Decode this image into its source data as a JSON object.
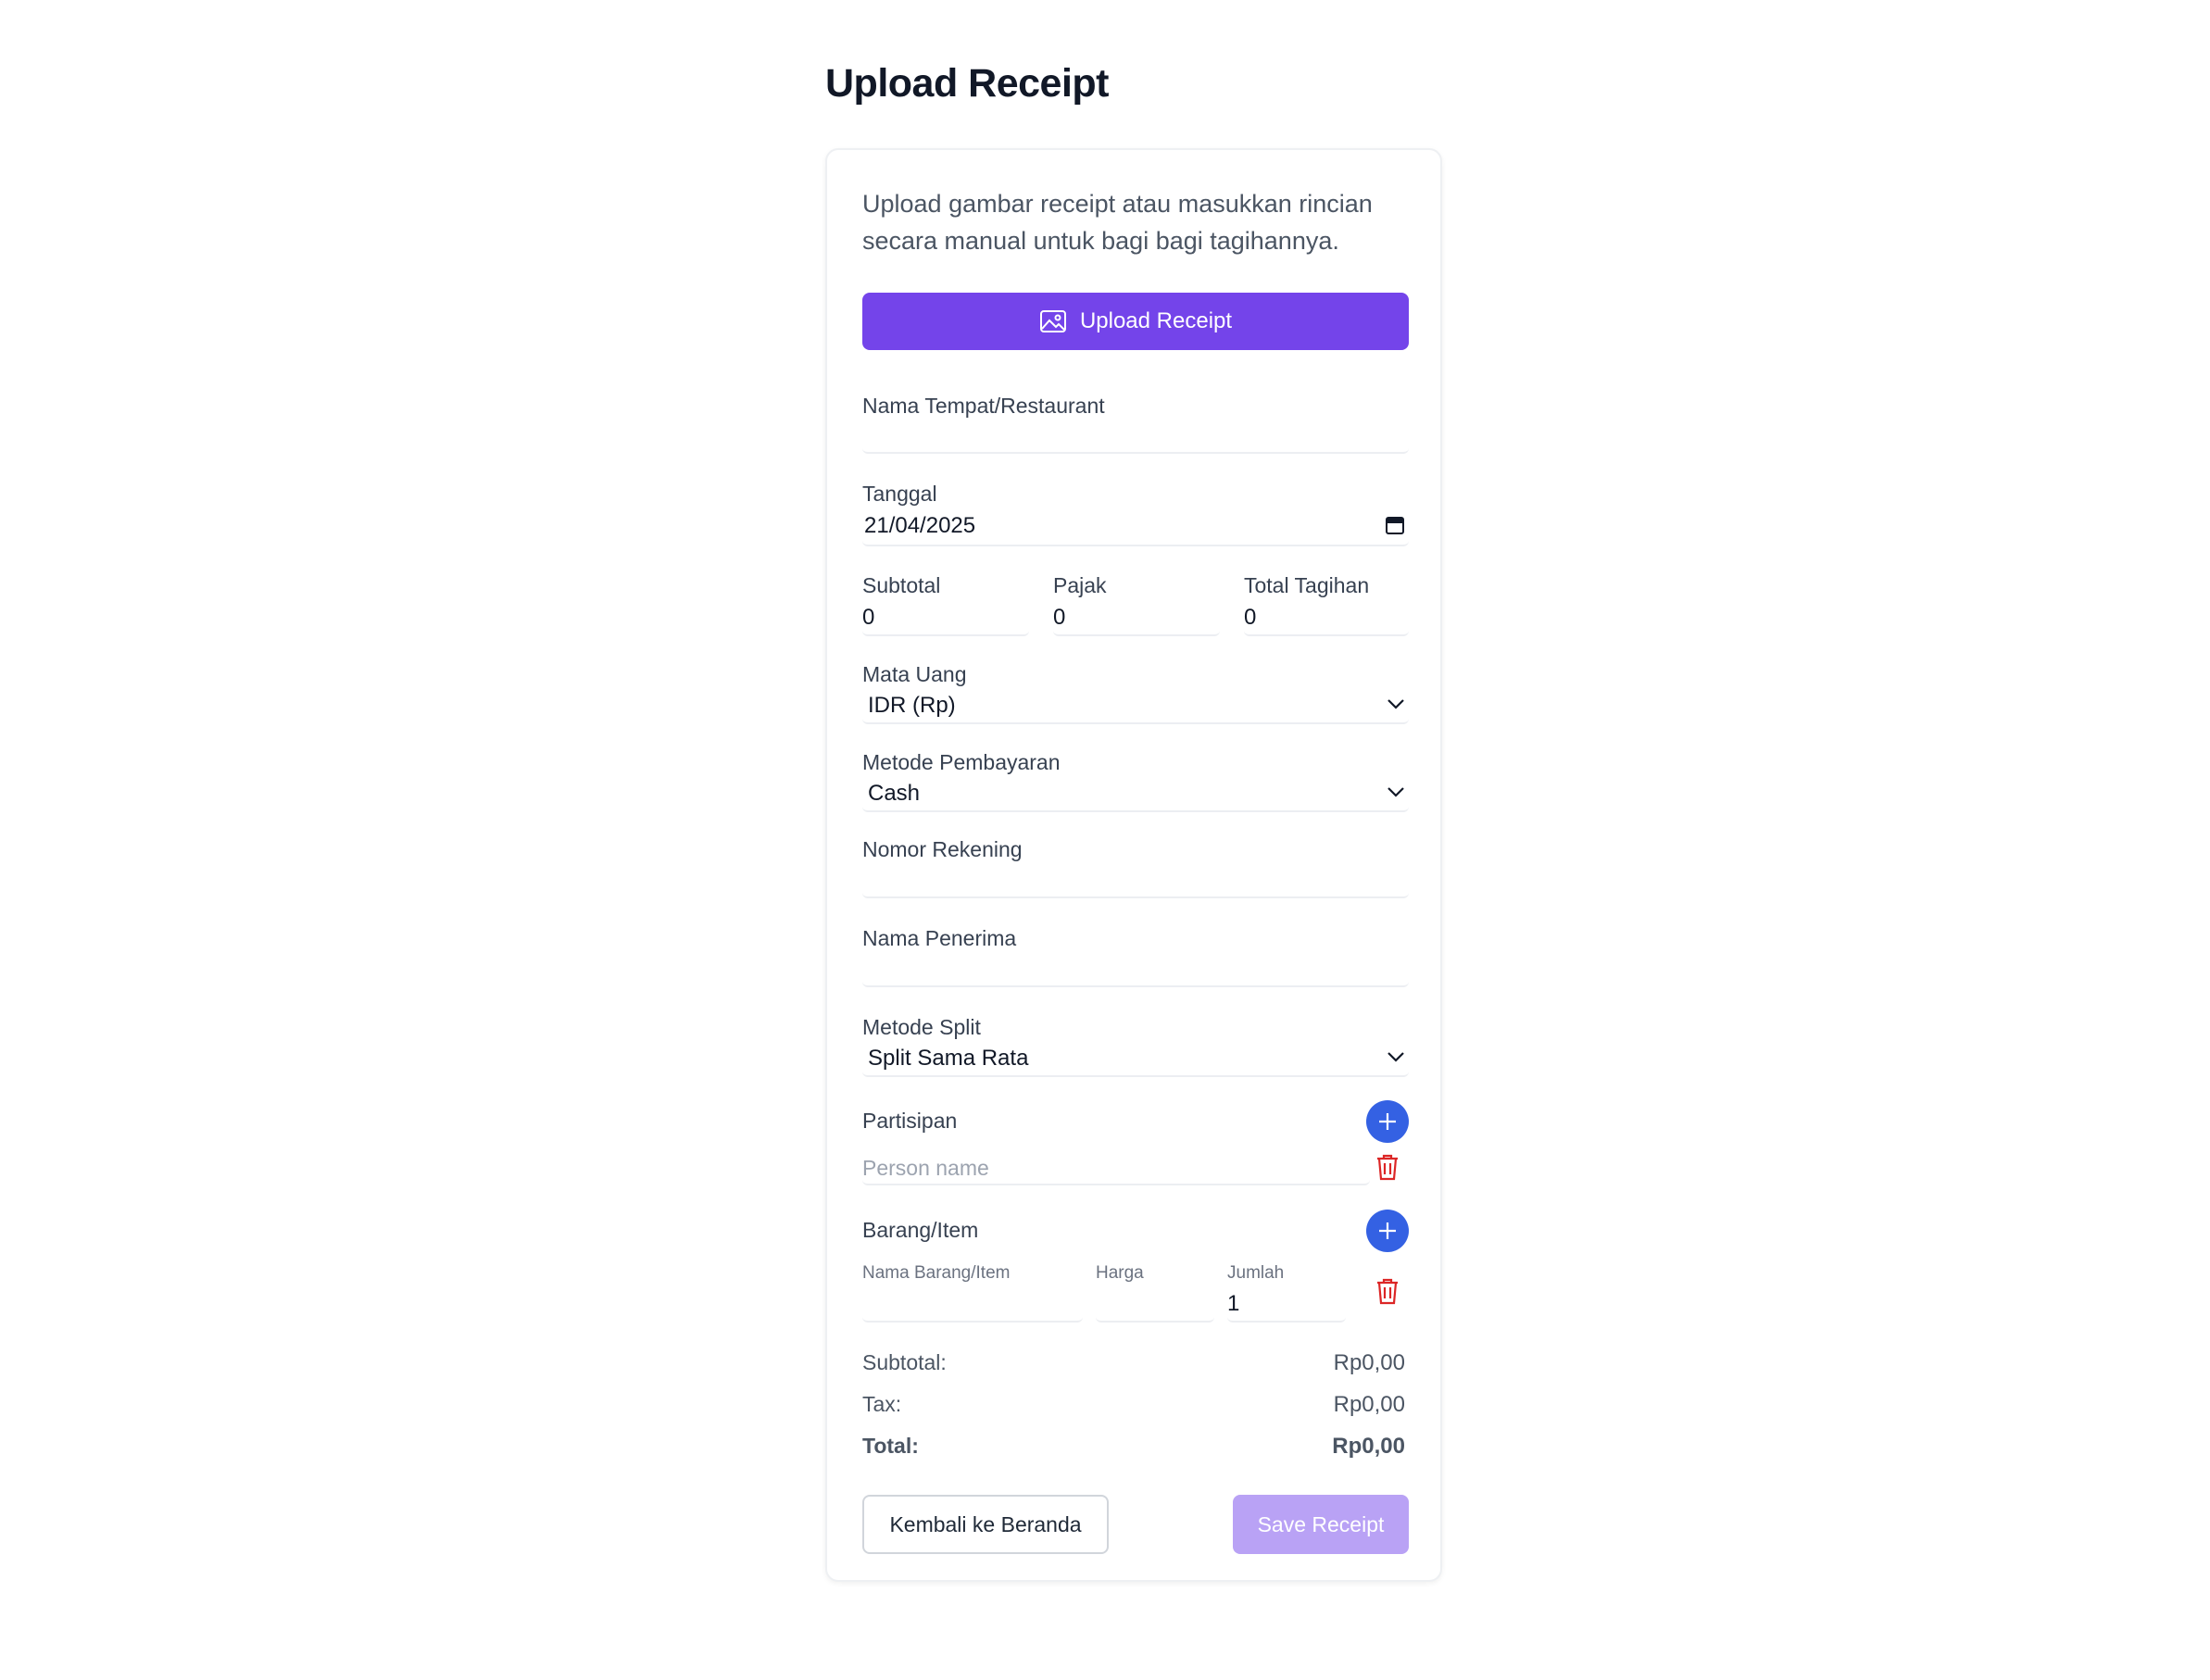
{
  "page": {
    "title": "Upload Receipt"
  },
  "form": {
    "intro": "Upload gambar receipt atau masukkan rincian secara manual untuk bagi bagi tagihannya.",
    "upload_button": "Upload Receipt",
    "place_label": "Nama Tempat/Restaurant",
    "place_value": "",
    "date_label": "Tanggal",
    "date_value": "21/04/2025",
    "subtotal_label": "Subtotal",
    "subtotal_value": "0",
    "tax_label": "Pajak",
    "tax_value": "0",
    "total_label": "Total Tagihan",
    "total_value": "0",
    "currency_label": "Mata Uang",
    "currency_value": "IDR (Rp)",
    "payment_label": "Metode Pembayaran",
    "payment_value": "Cash",
    "account_label": "Nomor Rekening",
    "account_value": "",
    "recipient_label": "Nama Penerima",
    "recipient_value": "",
    "split_label": "Metode Split",
    "split_value": "Split Sama Rata",
    "participants_label": "Partisipan",
    "participant_placeholder": "Person name",
    "items_label": "Barang/Item",
    "item_name_label": "Nama Barang/Item",
    "item_price_label": "Harga",
    "item_qty_label": "Jumlah",
    "item_qty_value": "1"
  },
  "summary": {
    "subtotal_label": "Subtotal:",
    "subtotal_value": "Rp0,00",
    "tax_label": "Tax:",
    "tax_value": "Rp0,00",
    "total_label": "Total:",
    "total_value": "Rp0,00"
  },
  "actions": {
    "back_label": "Kembali ke Beranda",
    "save_label": "Save Receipt"
  },
  "colors": {
    "primary": "#7444ea",
    "primary_disabled": "#b9a2f5",
    "add_button": "#3461e3",
    "delete_icon": "#dc2626"
  },
  "icons": {
    "upload": "image-icon",
    "calendar": "calendar-icon",
    "dropdown": "chevron-down-icon",
    "add": "plus-icon",
    "delete": "trash-icon"
  }
}
